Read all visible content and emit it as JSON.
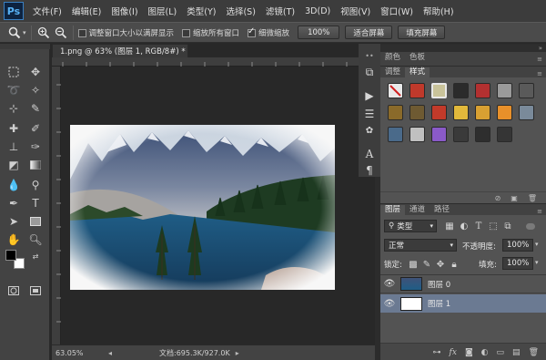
{
  "app": {
    "logo": "Ps"
  },
  "menu": [
    "文件(F)",
    "编辑(E)",
    "图像(I)",
    "图层(L)",
    "类型(Y)",
    "选择(S)",
    "滤镜(T)",
    "3D(D)",
    "视图(V)",
    "窗口(W)",
    "帮助(H)"
  ],
  "options": {
    "tool_icon": "zoom-icon",
    "resize_windows": {
      "label": "调整窗口大小以满屏显示",
      "checked": false
    },
    "zoom_all": {
      "label": "缩放所有窗口",
      "checked": false
    },
    "scrubby_zoom": {
      "label": "细微缩放",
      "checked": true
    },
    "btn_100": "100%",
    "btn_fit": "适合屏幕",
    "btn_fill": "填充屏幕"
  },
  "document": {
    "tab_title": "1.png @ 63% (图层 1, RGB/8#) *",
    "zoom": "63.05%",
    "doc_size": "文档:695.3K/927.0K"
  },
  "panels": {
    "color_tabs": [
      "颜色",
      "色板"
    ],
    "adjust_tabs": [
      "调整",
      "样式"
    ],
    "layer_tabs": [
      "图层",
      "通道",
      "路径"
    ],
    "filter_kind": "类型",
    "blend_mode": "正常",
    "opacity_label": "不透明度:",
    "opacity_value": "100%",
    "lock_label": "锁定:",
    "fill_label": "填充:",
    "fill_value": "100%",
    "layers": [
      {
        "name": "图层 0",
        "selected": false
      },
      {
        "name": "图层 1",
        "selected": true
      }
    ]
  },
  "styles_swatches": [
    {
      "color": "#e9e9e9",
      "icon": "no-style"
    },
    {
      "color": "#c0392b"
    },
    {
      "color": "#c9c39a"
    },
    {
      "color": "#2b2b2b"
    },
    {
      "color": "#b33030"
    },
    {
      "color": "#9a9a9a"
    },
    {
      "color": "#5a5a5a"
    },
    {
      "color": "#8a6a2a"
    },
    {
      "color": "#6e5a32"
    },
    {
      "color": "#c23a2a"
    },
    {
      "color": "#e2b93b"
    },
    {
      "color": "#d8a032"
    },
    {
      "color": "#e8902a"
    },
    {
      "color": "#7a8a9a"
    },
    {
      "color": "#4a6a8a"
    },
    {
      "color": "#c0c0c0"
    },
    {
      "color": "#8a5ac8"
    },
    {
      "color": "#3a3a3a"
    },
    {
      "color": "#2e2e2e"
    },
    {
      "color": "#353535"
    }
  ]
}
